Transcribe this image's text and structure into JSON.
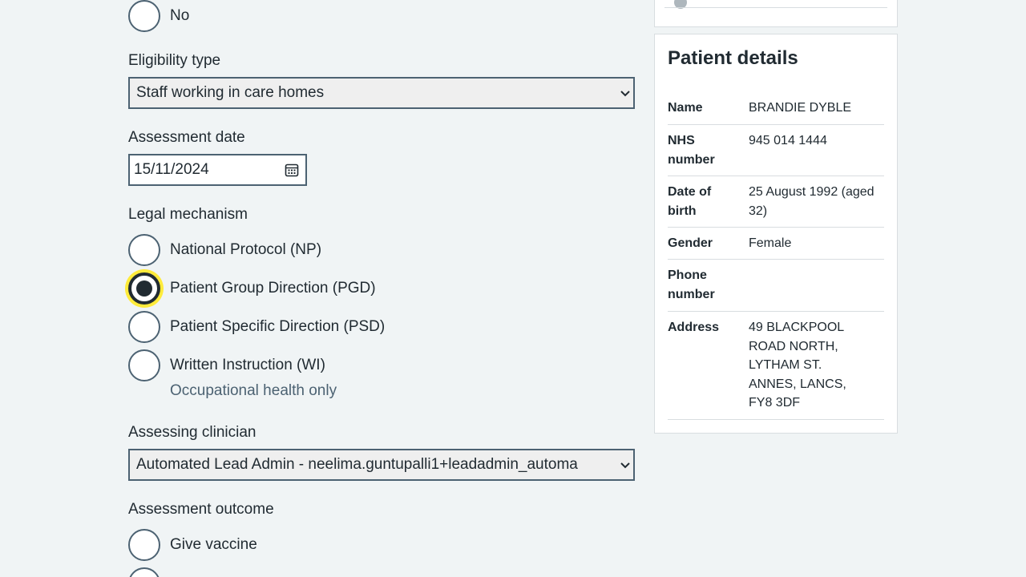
{
  "top_radio": {
    "label": "No"
  },
  "eligibility": {
    "label": "Eligibility type",
    "selected": "Staff working in care homes"
  },
  "assessment_date": {
    "label": "Assessment date",
    "value": "15/11/2024",
    "icon": "calendar-icon"
  },
  "legal_mechanism": {
    "label": "Legal mechanism",
    "options": [
      {
        "label": "National Protocol (NP)",
        "checked": false
      },
      {
        "label": "Patient Group Direction (PGD)",
        "checked": true
      },
      {
        "label": "Patient Specific Direction (PSD)",
        "checked": false
      },
      {
        "label": "Written Instruction (WI)",
        "checked": false
      }
    ],
    "wi_hint": "Occupational health only"
  },
  "assessing_clinician": {
    "label": "Assessing clinician",
    "selected": "Automated Lead Admin - neelima.guntupalli1+leadadmin_automa"
  },
  "assessment_outcome": {
    "label": "Assessment outcome",
    "options": [
      {
        "label": "Give vaccine"
      }
    ]
  },
  "patient_details": {
    "title": "Patient details",
    "rows": [
      {
        "key": "Name",
        "value": "BRANDIE DYBLE"
      },
      {
        "key": "NHS number",
        "value": "945 014 1444"
      },
      {
        "key": "Date of birth",
        "value": "25 August 1992 (aged 32)"
      },
      {
        "key": "Gender",
        "value": "Female"
      },
      {
        "key": "Phone number",
        "value": ""
      },
      {
        "key": "Address",
        "value": "49 BLACKPOOL ROAD NORTH, LYTHAM ST. ANNES, LANCS, FY8 3DF"
      }
    ]
  },
  "colors": {
    "background": "#f0f4f5",
    "text": "#212b32",
    "border": "#4c6272",
    "focus": "#ffeb3b",
    "hint": "#4c6272"
  }
}
